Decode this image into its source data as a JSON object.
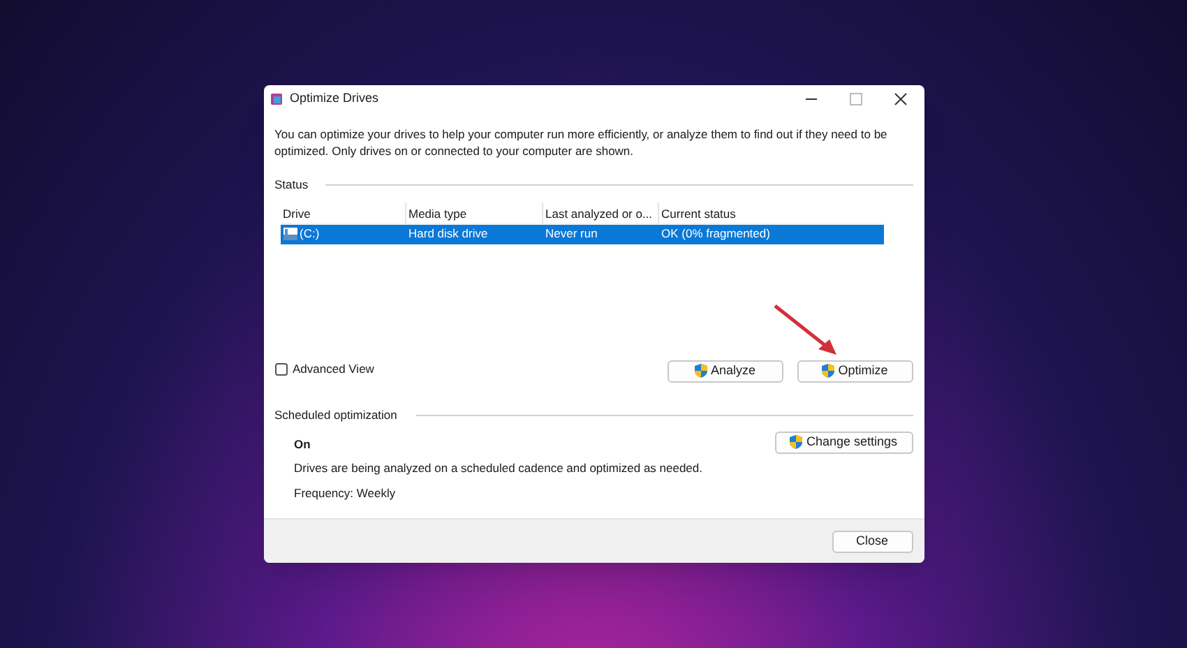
{
  "window": {
    "title": "Optimize Drives"
  },
  "description": "You can optimize your drives to help your computer run more efficiently, or analyze them to find out if they need to be optimized. Only drives on or connected to your computer are shown.",
  "status": {
    "heading": "Status",
    "table": {
      "columns": [
        "Drive",
        "Media type",
        "Last analyzed or o...",
        "Current status"
      ],
      "rows": [
        {
          "selected": true,
          "cells": [
            "(C:)",
            "Hard disk drive",
            "Never run",
            "OK (0% fragmented)"
          ]
        }
      ]
    }
  },
  "advanced_view": {
    "label": "Advanced View",
    "checked": false
  },
  "actions": [
    "Analyze",
    "Optimize"
  ],
  "scheduled": {
    "heading": "Scheduled optimization",
    "state": "On",
    "detail": "Drives are being analyzed on a scheduled cadence and optimized as needed.",
    "frequency": "Frequency: Weekly",
    "button": "Change settings"
  },
  "footer": {
    "button": "Close"
  }
}
